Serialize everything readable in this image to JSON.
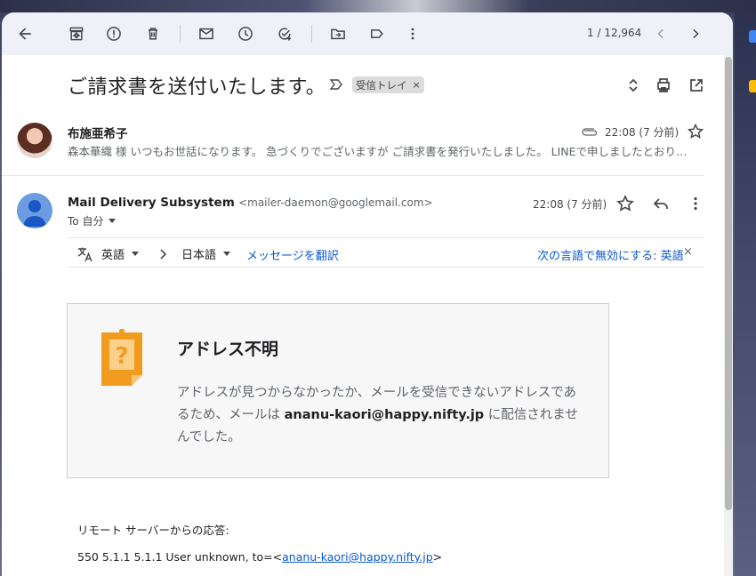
{
  "toolbar": {
    "pager": "1 / 12,964"
  },
  "message": {
    "subject": "ご請求書を送付いたします。",
    "label": "受信トレイ",
    "label_remove": "×"
  },
  "thread_item1": {
    "sender": "布施亜希子",
    "time": "22:08 (7 分前)",
    "snippet": "森本華織 様 いつもお世話になります。 急づくりでございますが ご請求書を発行いたしました。 LINEで申しましたとおり…"
  },
  "thread_item2": {
    "sender_name": "Mail Delivery Subsystem",
    "sender_email": "<mailer-daemon@googlemail.com>",
    "time": "22:08 (7 分前)",
    "to": "To 自分"
  },
  "translate_bar": {
    "from_lang": "英語",
    "to_lang": "日本語",
    "translate_link": "メッセージを翻訳",
    "disable_link": "次の言語で無効にする: 英語",
    "close": "×"
  },
  "bounce_card": {
    "title": "アドレス不明",
    "body_pre": "アドレスが見つからなかったか、メールを受信できないアドレスであるため、メールは ",
    "address": "ananu-kaori@happy.nifty.jp",
    "body_post": " に配信されませんでした。"
  },
  "remote_response": {
    "label": "リモート サーバーからの応答:",
    "code_text": "550 5.1.1 5.1.1 User unknown, to=<",
    "link": "ananu-kaori@happy.nifty.jp",
    "close_bracket": ">"
  },
  "colors": {
    "toolbar_bg": "#eef1f8",
    "link_blue": "#0b57d0",
    "card_icon_orange": "#f29c1f"
  }
}
